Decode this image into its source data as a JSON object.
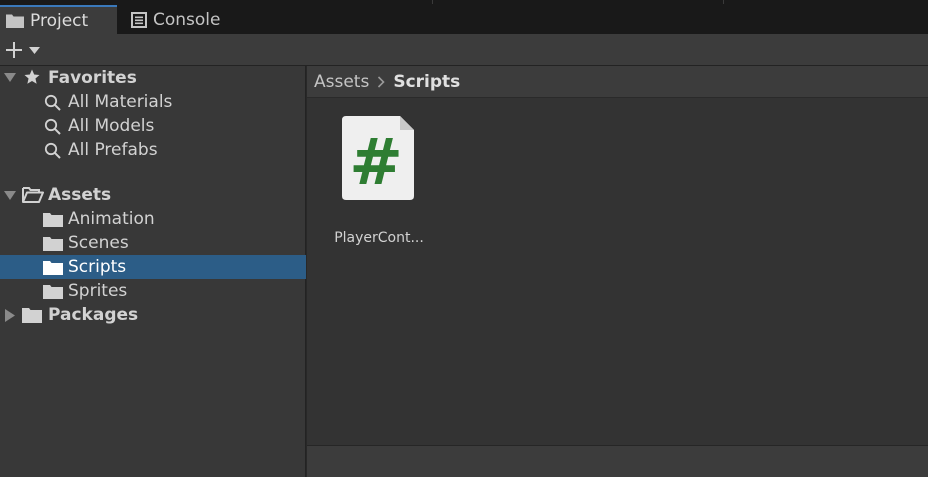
{
  "tabs": [
    {
      "label": "Project",
      "icon": "folder-icon",
      "active": true
    },
    {
      "label": "Console",
      "icon": "console-icon",
      "active": false
    }
  ],
  "toolbar": {
    "add_icon": "plus-icon",
    "dropdown_icon": "caret-down-icon"
  },
  "tree": {
    "favorites": {
      "label": "Favorites",
      "icon": "star-icon",
      "items": [
        {
          "label": "All Materials",
          "icon": "search-icon"
        },
        {
          "label": "All Models",
          "icon": "search-icon"
        },
        {
          "label": "All Prefabs",
          "icon": "search-icon"
        }
      ]
    },
    "assets": {
      "label": "Assets",
      "icon": "folder-open-icon",
      "items": [
        {
          "label": "Animation",
          "icon": "folder-icon"
        },
        {
          "label": "Scenes",
          "icon": "folder-icon"
        },
        {
          "label": "Scripts",
          "icon": "folder-icon",
          "selected": true
        },
        {
          "label": "Sprites",
          "icon": "folder-icon"
        }
      ]
    },
    "packages": {
      "label": "Packages",
      "icon": "folder-icon"
    }
  },
  "breadcrumb": {
    "root": "Assets",
    "current": "Scripts"
  },
  "assets_view": {
    "items": [
      {
        "label": "PlayerCont...",
        "icon": "csharp-script-icon",
        "glyph": "#"
      }
    ]
  },
  "colors": {
    "selection": "#2c5d87",
    "tab_accent": "#3a79bb",
    "script_glyph": "#2e7d32",
    "panel_bg": "#383838"
  }
}
